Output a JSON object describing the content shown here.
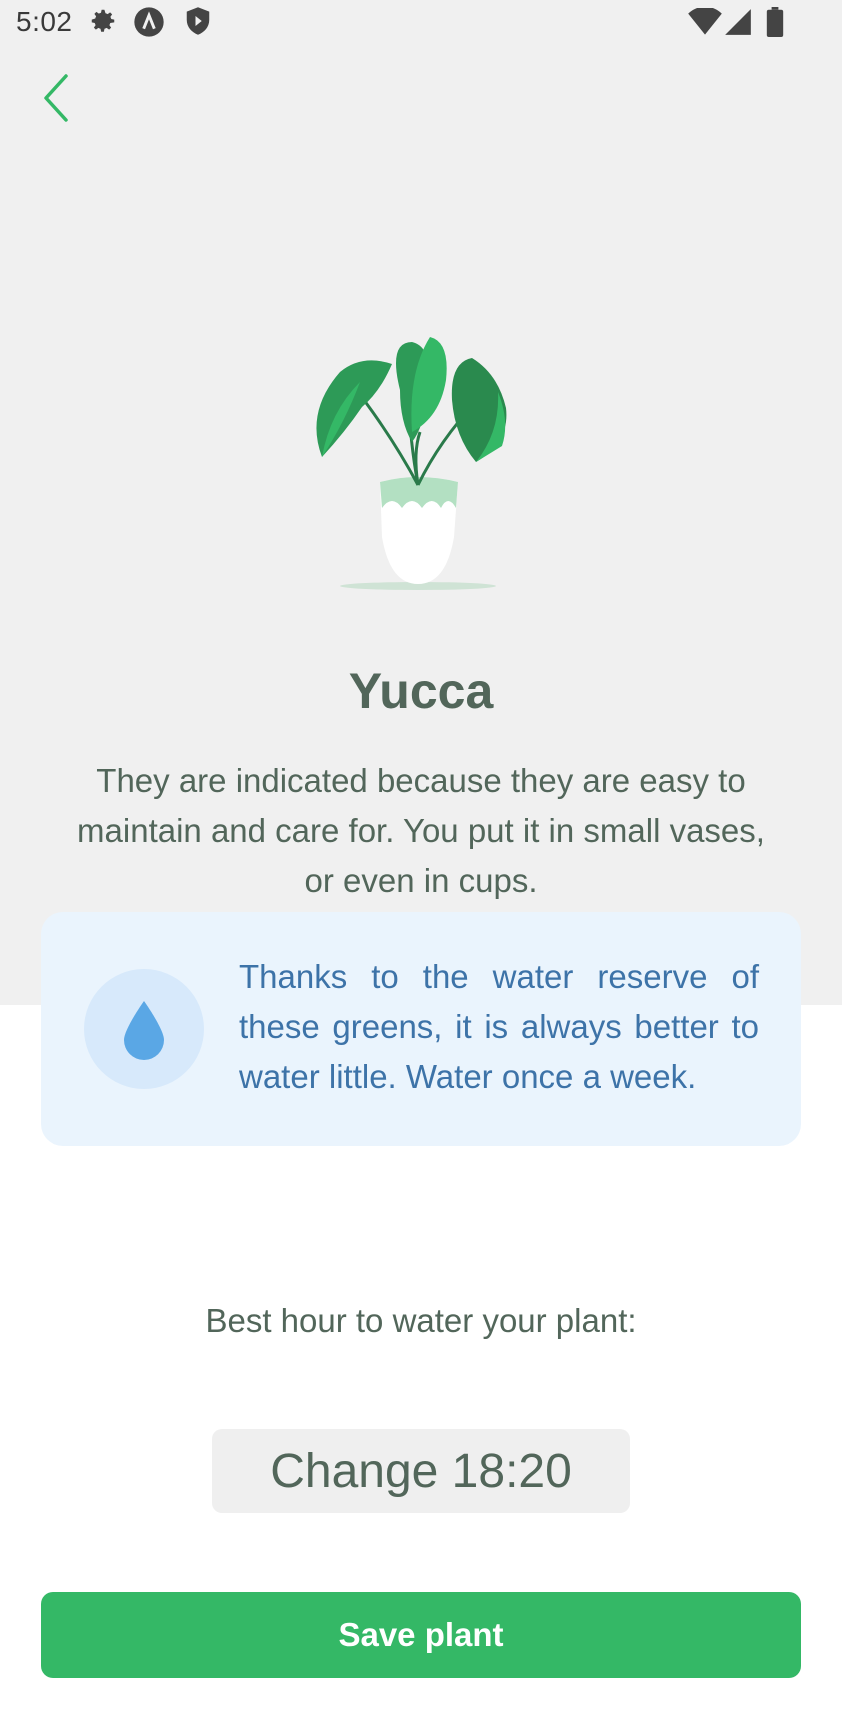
{
  "status_bar": {
    "time": "5:02",
    "left_icons": [
      "gear-icon",
      "a-circle-icon",
      "shield-play-icon"
    ],
    "right_icons": [
      "wifi-icon",
      "signal-icon",
      "battery-icon"
    ]
  },
  "header": {
    "back_icon": "chevron-left-icon"
  },
  "plant": {
    "name": "Yucca",
    "description": "They are indicated because they are easy to maintain and care for. You put it in small vases, or even in cups."
  },
  "water_tip": {
    "icon": "water-drop-icon",
    "text": "Thanks to the water reserve of these greens, it is always better to water little. Water once a week."
  },
  "schedule": {
    "label": "Best hour to water your plant:",
    "change_button_label": "Change 18:20"
  },
  "actions": {
    "save_label": "Save plant"
  },
  "colors": {
    "accent": "#34b866",
    "tip_background": "#eaf4fd",
    "tip_text": "#3d73a8",
    "top_background": "#f0f0f0"
  }
}
